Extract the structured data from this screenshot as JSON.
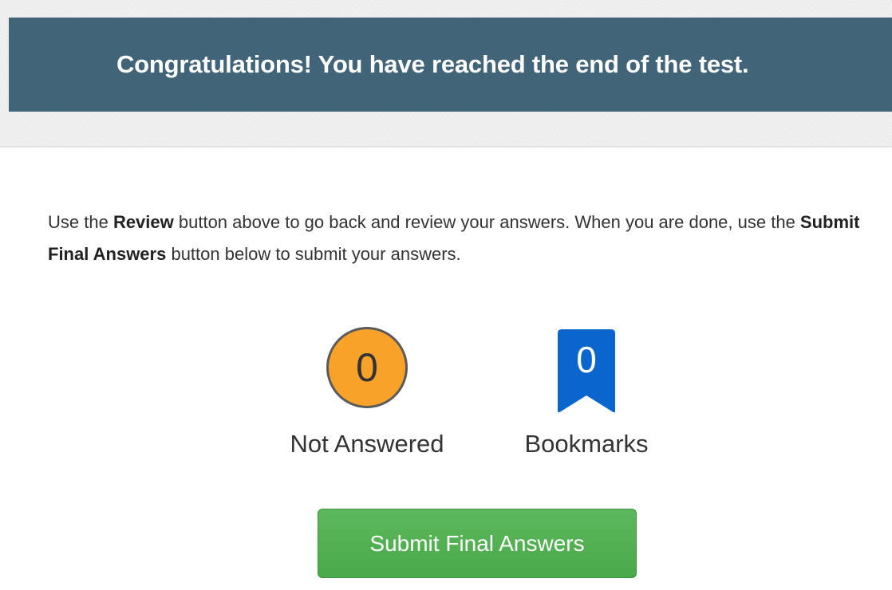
{
  "banner": {
    "title": "Congratulations! You have reached the end of the test."
  },
  "instructions": {
    "part1": "Use the ",
    "review_label": "Review",
    "part2": " button above to go back and review your answers. When you are done, use the ",
    "submit_label": "Submit Final Answers",
    "part3": " button below to submit your answers."
  },
  "stats": {
    "not_answered": {
      "count": "0",
      "label": "Not Answered",
      "icon": "circle-icon",
      "color": "#f8a22a"
    },
    "bookmarks": {
      "count": "0",
      "label": "Bookmarks",
      "icon": "bookmark-icon",
      "color": "#0a66cc"
    }
  },
  "submit_button": {
    "label": "Submit Final Answers",
    "color": "#5cb85c"
  },
  "colors": {
    "banner_bg": "#416479",
    "banner_text": "#ffffff"
  }
}
